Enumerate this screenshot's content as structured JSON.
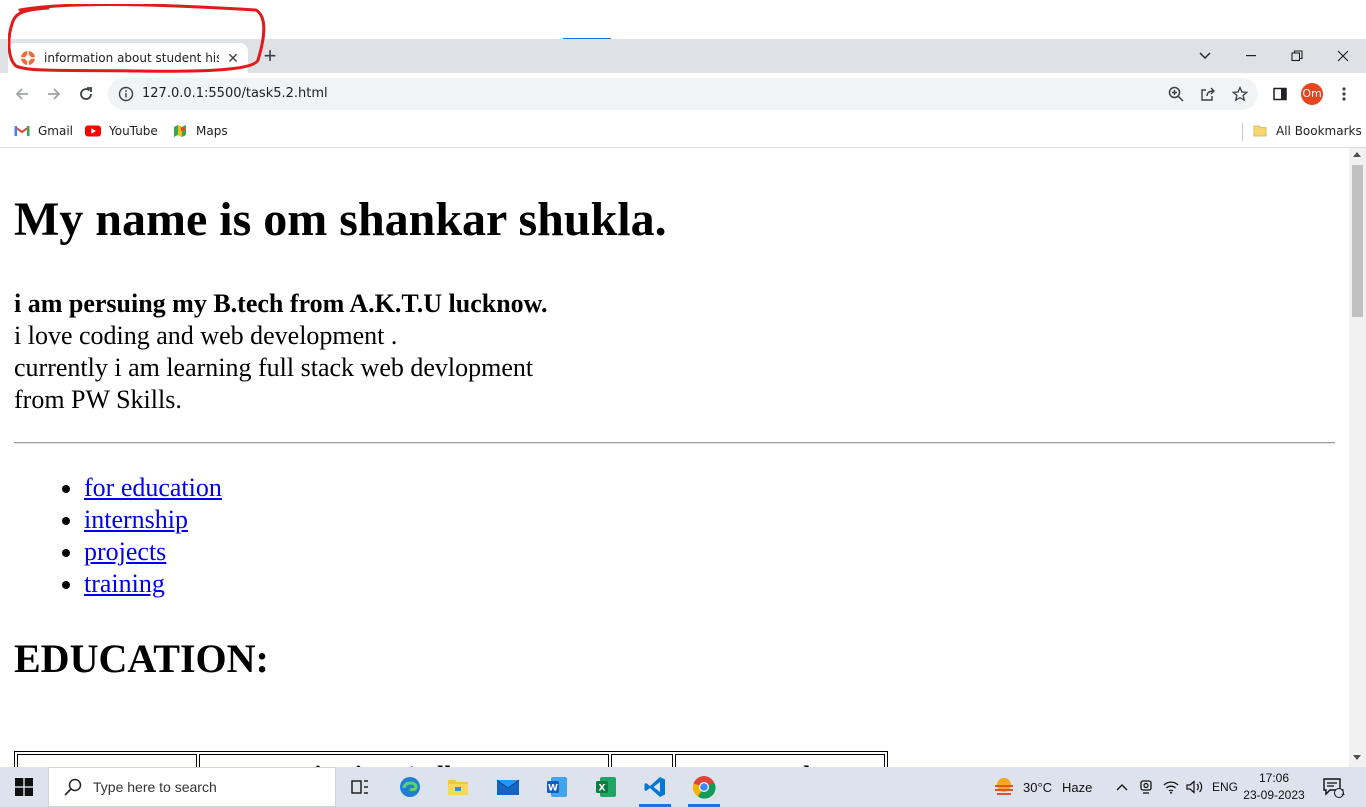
{
  "browser": {
    "tab": {
      "title": "information about student his ed"
    },
    "address_bar": {
      "url": "127.0.0.1:5500/task5.2.html"
    },
    "profile_initials": "Om",
    "bookmarks": [
      {
        "label": "Gmail",
        "icon": "gmail-icon"
      },
      {
        "label": "YouTube",
        "icon": "youtube-icon"
      },
      {
        "label": "Maps",
        "icon": "maps-icon"
      }
    ],
    "all_bookmarks_label": "All Bookmarks"
  },
  "page": {
    "heading": "My name is om shankar shukla.",
    "intro_bold": "i am persuing my B.tech from A.K.T.U lucknow.",
    "intro_lines": [
      "i love coding and web development .",
      "currently i am learning full stack web devlopment",
      "from PW Skills."
    ],
    "links": [
      "for education",
      "internship",
      "projects",
      "training"
    ],
    "section_heading": "EDUCATION:",
    "table_headers": [
      "",
      "institute/colle",
      "",
      "result"
    ]
  },
  "taskbar": {
    "search_placeholder": "Type here to search",
    "weather": {
      "temp": "30°C",
      "condition": "Haze"
    },
    "language": "ENG",
    "time": "17:06",
    "date": "23-09-2023",
    "notification_count": "1"
  },
  "colors": {
    "tab_strip_bg": "#dee1e6",
    "link": "#0000ee",
    "avatar": "#e8441e",
    "annotation": "#e11b1b",
    "taskbar_bg": "#dde3ed"
  }
}
